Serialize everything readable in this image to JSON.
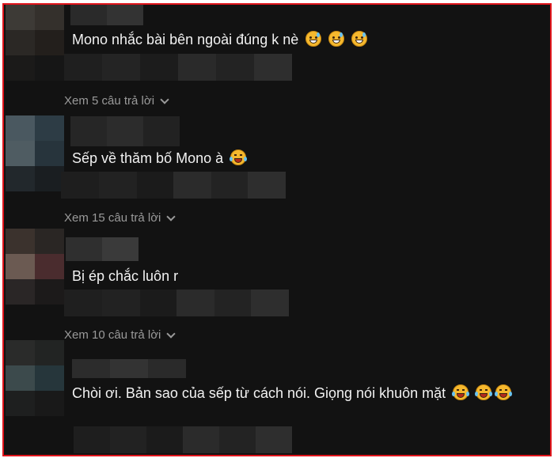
{
  "comments": [
    {
      "text": "Mono nhắc bài bên ngoài đúng k nè",
      "emojis": [
        "grinning-sweat-icon",
        "grinning-sweat-icon",
        "grinning-sweat-icon"
      ],
      "replies_label": "Xem 5 câu trả lời"
    },
    {
      "text": "Sếp về thăm bố Mono à",
      "emojis": [
        "tears-of-joy-icon"
      ],
      "replies_label": "Xem 15 câu trả lời"
    },
    {
      "text": "Bị ép chắc luôn r",
      "emojis": [],
      "replies_label": "Xem 10 câu trả lời"
    },
    {
      "text": "Chòi ơi. Bản sao của sếp từ cách nói. Giọng nói khuôn mặt",
      "emojis": [
        "tears-of-joy-icon",
        "tears-of-joy-icon",
        "tears-of-joy-icon"
      ],
      "replies_label": ""
    }
  ],
  "colors": {
    "background": "#121212",
    "frame_border": "#e0141b",
    "comment_text": "#f2f2f2",
    "replies_text": "#9a9a9a"
  }
}
